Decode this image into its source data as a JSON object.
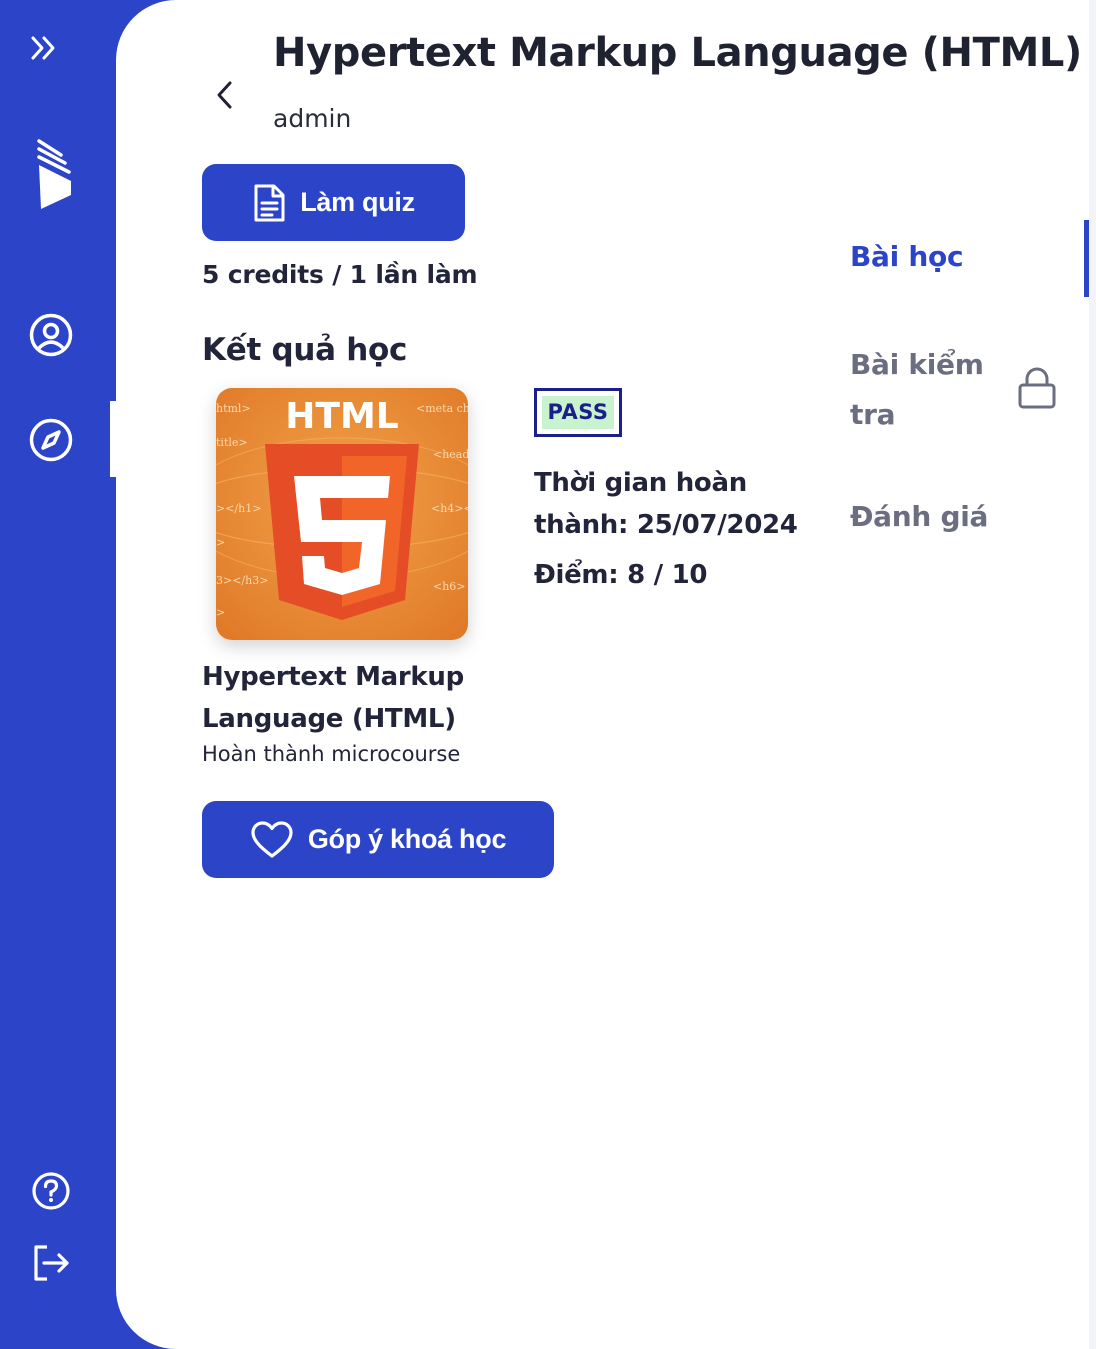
{
  "sidebar": {
    "icons": [
      "double-chevron-right-icon",
      "logo-icon",
      "user-circle-icon",
      "compass-icon",
      "help-circle-icon",
      "logout-icon"
    ]
  },
  "header": {
    "title": "Hypertext Markup Language (HTML)",
    "author": "admin"
  },
  "quiz": {
    "button_label": "Làm quiz",
    "credits_text": "5 credits / 1 lần làm"
  },
  "results": {
    "section_title": "Kết quả học",
    "course_name": "Hypertext Markup Language (HTML)",
    "course_subtitle": "Hoàn thành microcourse",
    "status_badge": "PASS",
    "finish_time": "Thời gian hoàn thành: 25/07/2024",
    "score": "Điểm: 8 / 10"
  },
  "feedback": {
    "button_label": "Góp ý khoá học"
  },
  "nav": {
    "lessons": "Bài học",
    "test": "Bài kiểm tra",
    "review": "Đánh giá"
  },
  "thumbnail": {
    "logo_text": "HTML",
    "shield_number": "5",
    "code_snippets": [
      "html>",
      "<meta ch",
      "title>",
      "<head",
      "></h1>",
      "<h4><",
      ">",
      "3></h3>",
      "<h6>",
      ">"
    ]
  },
  "colors": {
    "brand": "#2c44c8",
    "pass_bg": "#c9f3cf",
    "pass_text": "#1b1f8a",
    "html_orange": "#e38a34"
  }
}
